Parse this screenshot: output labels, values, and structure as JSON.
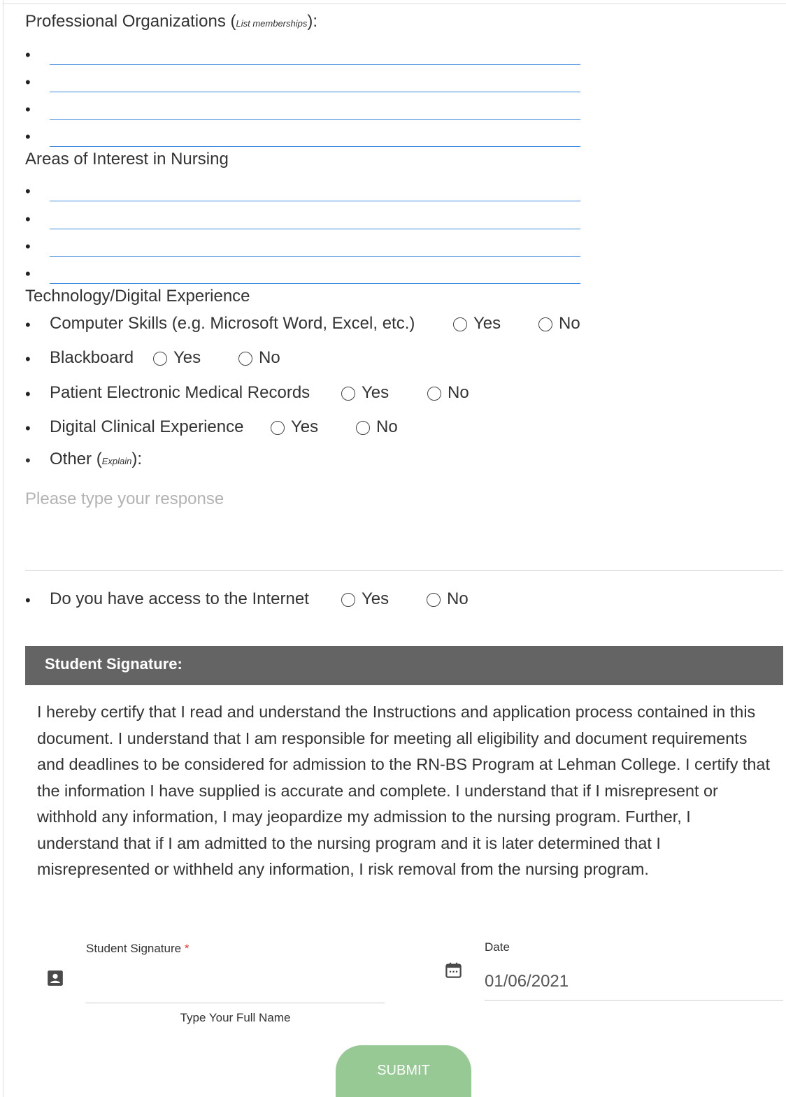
{
  "professional_organizations": {
    "label": "Professional Organizations (",
    "hint": "List memberships",
    "suffix": "):",
    "bullet": "•",
    "lines": [
      "",
      "",
      "",
      ""
    ]
  },
  "areas_of_interest": {
    "label": "Areas of Interest in Nursing",
    "lines": [
      "",
      "",
      "",
      ""
    ]
  },
  "technology": {
    "label": "Technology/Digital Experience",
    "yes_label": "Yes",
    "no_label": "No",
    "questions": [
      {
        "label": "Computer Skills (e.g. Microsoft Word, Excel, etc.)"
      },
      {
        "label": "Blackboard"
      },
      {
        "label": "Patient Electronic Medical Records"
      },
      {
        "label": "Digital Clinical Experience"
      }
    ],
    "other": {
      "label": "Other (",
      "hint": "Explain",
      "suffix": "):"
    },
    "response_placeholder": "Please type your response",
    "internet": {
      "label": "Do you have access to the Internet"
    }
  },
  "signature_section": {
    "header": "Student Signature:",
    "certification": "I hereby certify that I read and understand the Instructions and application process contained in this document. I understand that I am responsible for meeting all eligibility and document requirements and deadlines to be considered for admission to the RN-BS Program at Lehman College. I certify that the information I have supplied is accurate and complete. I understand that if I misrepresent or withhold any information, I may jeopardize my admission to the nursing program. Further, I understand that if I am admitted to the nursing program and it is later determined that I misrepresented or withheld any information, I risk removal from the nursing program.",
    "signature_label": "Student Signature",
    "required_mark": "*",
    "signature_value": "",
    "signature_hint": "Type Your Full Name",
    "date_label": "Date",
    "date_value": "01/06/2021",
    "submit_label": "SUBMIT",
    "submit_color": "#97c994",
    "header_color": "#646464",
    "input_line_color": "#3e8bdf"
  },
  "icons": [
    "person-card-icon",
    "calendar-icon"
  ]
}
